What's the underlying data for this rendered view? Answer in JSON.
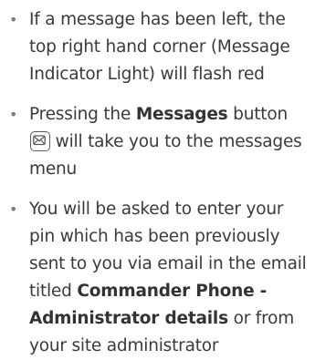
{
  "bullets": [
    {
      "text": "If a message has been left, the top right hand corner (Message Indicator Light) will flash red"
    },
    {
      "pre": "Pressing the ",
      "bold": "Messages",
      "mid": " button",
      "icon": "envelope-icon",
      "post": " will take you to the messages menu"
    },
    {
      "pre": "You will be asked to enter your pin which has been previously sent to you via email in the email titled ",
      "bold": "Commander Phone - Administrator details",
      "post": " or from your site administrator"
    }
  ],
  "colors": {
    "text": "#3a3a3a",
    "bullet": "#7a7a7a"
  }
}
